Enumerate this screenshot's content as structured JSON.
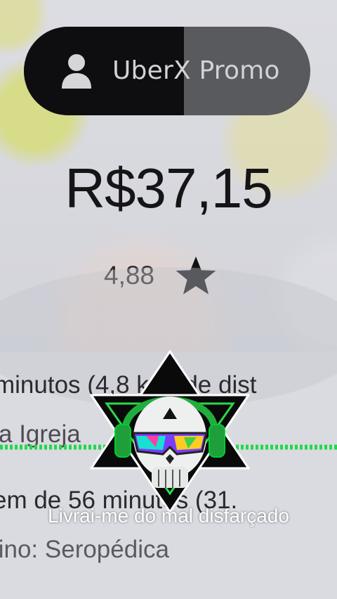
{
  "product": {
    "name": "UberX Promo",
    "icon": "person-icon"
  },
  "fare": "R$37,15",
  "rider": {
    "rating": "4,88",
    "icon": "star-icon"
  },
  "trip_info": {
    "line1": "minutos (4,8 km) de dist",
    "line2": "a Igreja",
    "line2_end": "a",
    "line3": "em de 56 minutos (31.",
    "line4": "tino: Seropédica"
  },
  "overlay": {
    "caption": "Livrai-me do mal disfarçado",
    "emblem": "skull-headphones-emblem",
    "wave_color": "#22d84a"
  },
  "colors": {
    "pill_dark": "#0e0e10",
    "pill_light": "#595a5e",
    "text": "#151518"
  }
}
